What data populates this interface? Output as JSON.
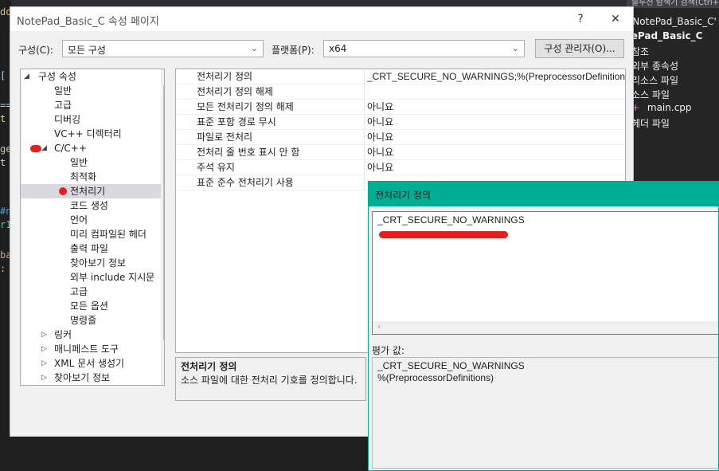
{
  "ide": {
    "search_hint": "솔루션 탐색기 검색(Ctrl+;)",
    "solution_items": [
      "'NotePad_Basic_C' (",
      "tePad_Basic_C",
      "참조",
      "외부 종속성",
      "리소스 파일",
      "소스 파일",
      "main.cpp",
      "헤더 파일"
    ]
  },
  "dialog": {
    "title": "NotePad_Basic_C 속성 페이지",
    "help_btn": "?",
    "close_btn": "✕",
    "config_label": "구성(C):",
    "config_value": "모든 구성",
    "platform_label": "플랫폼(P):",
    "platform_value": "x64",
    "config_manager_btn": "구성 관리자(O)...",
    "tree": [
      "구성 속성",
      "일반",
      "고급",
      "디버깅",
      "VC++ 디렉터리",
      "C/C++",
      "일반",
      "최적화",
      "전처리기",
      "코드 생성",
      "언어",
      "미리 컴파일된 헤더",
      "출력 파일",
      "찾아보기 정보",
      "외부 include 지시문",
      "고급",
      "모든 옵션",
      "명령줄",
      "링커",
      "매니페스트 도구",
      "XML 문서 생성기",
      "찾아보기 정보"
    ],
    "grid": [
      {
        "name": "전처리기 정의",
        "value": "_CRT_SECURE_NO_WARNINGS;%(PreprocessorDefinitions)"
      },
      {
        "name": "전처리기 정의 해제",
        "value": ""
      },
      {
        "name": "모든 전처리기 정의 해제",
        "value": "아니요"
      },
      {
        "name": "표준 포함 경로 무시",
        "value": "아니요"
      },
      {
        "name": "파일로 전처리",
        "value": "아니요"
      },
      {
        "name": "전처리 줄 번호 표시 안 함",
        "value": "아니요"
      },
      {
        "name": "주석 유지",
        "value": "아니요"
      },
      {
        "name": "표준 준수 전처리기 사용",
        "value": ""
      }
    ],
    "desc_title": "전처리기 정의",
    "desc_body": "소스 파일에 대한 전처리 기호를 정의합니다."
  },
  "popup": {
    "title": "전처리기 정의",
    "edit_text": "_CRT_SECURE_NO_WARNINGS",
    "eval_label": "평가 값:",
    "eval_lines": [
      "_CRT_SECURE_NO_WARNINGS",
      "%(PreprocessorDefinitions)"
    ]
  },
  "colors": {
    "popup_title": "#00ae93",
    "highlight_red": "#e02020",
    "selection": "#cde8ff"
  },
  "icons": [
    "collapse-arrow-icon",
    "expand-arrow-icon",
    "chevron-down-icon",
    "chevron-left-icon",
    "close-icon",
    "help-icon",
    "cpp-file-icon"
  ]
}
